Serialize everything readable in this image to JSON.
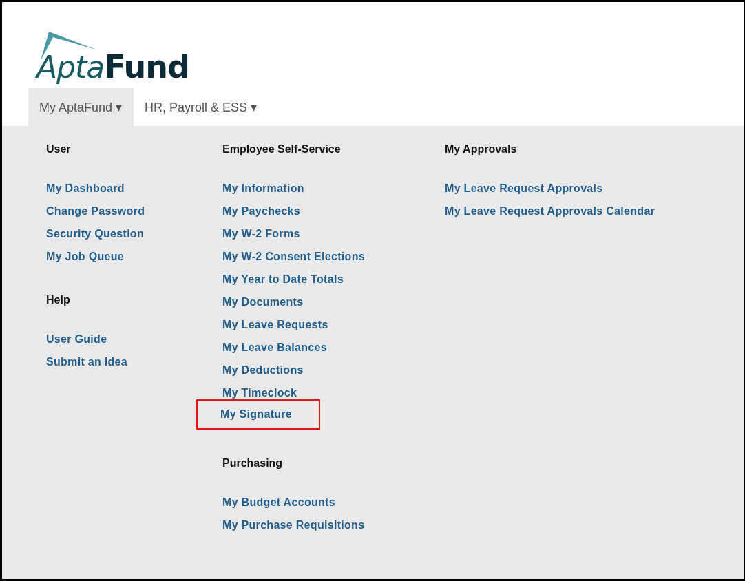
{
  "logo": {
    "light": "Apta",
    "bold": "Fund"
  },
  "tabs": [
    {
      "label": "My AptaFund",
      "caret": "▾",
      "selected": true
    },
    {
      "label": "HR, Payroll & ESS",
      "caret": "▾",
      "selected": false
    }
  ],
  "columns": [
    {
      "sections": [
        {
          "heading": "User",
          "links": [
            {
              "label": "My Dashboard",
              "highlighted": false
            },
            {
              "label": "Change Password",
              "highlighted": false
            },
            {
              "label": "Security Question",
              "highlighted": false
            },
            {
              "label": "My Job Queue",
              "highlighted": false
            }
          ]
        },
        {
          "heading": "Help",
          "links": [
            {
              "label": "User Guide",
              "highlighted": false
            },
            {
              "label": "Submit an Idea",
              "highlighted": false
            }
          ]
        }
      ]
    },
    {
      "sections": [
        {
          "heading": "Employee Self-Service",
          "links": [
            {
              "label": "My Information",
              "highlighted": false
            },
            {
              "label": "My Paychecks",
              "highlighted": false
            },
            {
              "label": "My W-2 Forms",
              "highlighted": false
            },
            {
              "label": "My W-2 Consent Elections",
              "highlighted": false
            },
            {
              "label": "My Year to Date Totals",
              "highlighted": false
            },
            {
              "label": "My Documents",
              "highlighted": false
            },
            {
              "label": "My Leave Requests",
              "highlighted": false
            },
            {
              "label": "My Leave Balances",
              "highlighted": false
            },
            {
              "label": "My Deductions",
              "highlighted": false
            },
            {
              "label": "My Timeclock",
              "highlighted": false
            },
            {
              "label": "My Signature",
              "highlighted": true
            }
          ]
        },
        {
          "heading": "Purchasing",
          "links": [
            {
              "label": "My Budget Accounts",
              "highlighted": false
            },
            {
              "label": "My Purchase Requisitions",
              "highlighted": false
            }
          ]
        }
      ]
    },
    {
      "sections": [
        {
          "heading": "My Approvals",
          "links": [
            {
              "label": "My Leave Request Approvals",
              "highlighted": false
            },
            {
              "label": "My Leave Request Approvals Calendar",
              "highlighted": false
            }
          ]
        }
      ]
    }
  ]
}
